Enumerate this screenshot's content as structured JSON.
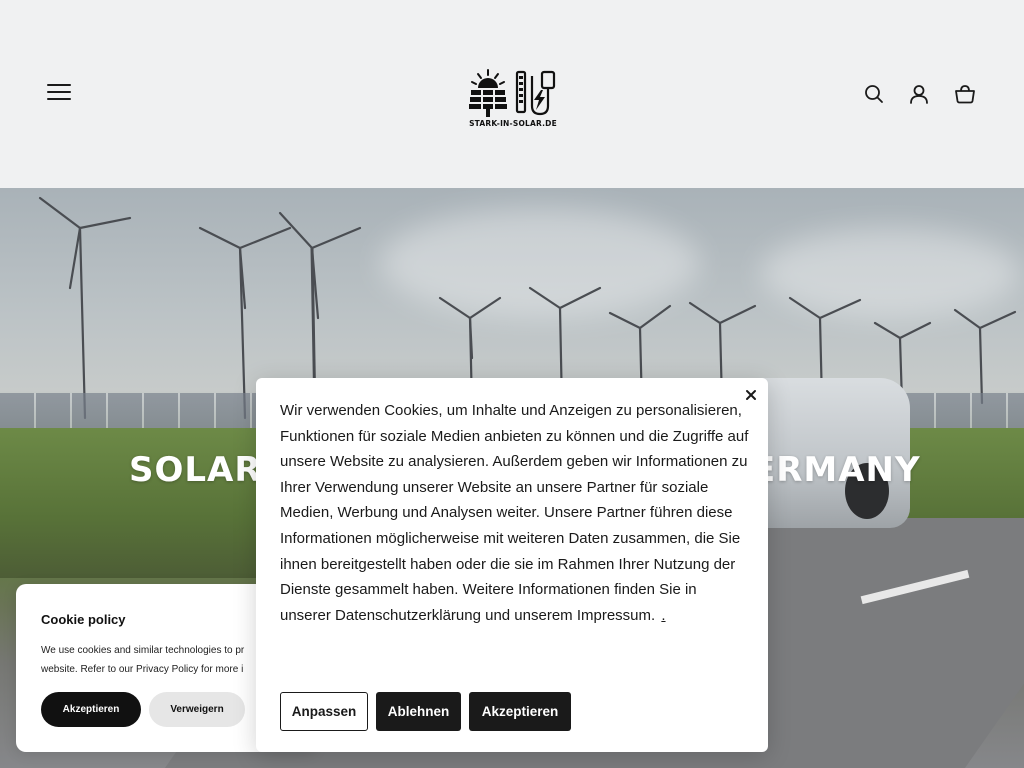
{
  "header": {
    "logo_text": "STARK-IN-SOLAR.DE",
    "menu_icon": "hamburger-menu-icon",
    "search_icon": "search-icon",
    "account_icon": "user-account-icon",
    "cart_icon": "shopping-basket-icon"
  },
  "hero": {
    "title_left": "SOLAR &",
    "title_right": "ERMANY"
  },
  "cookie_policy": {
    "title": "Cookie policy",
    "text_line1": "We use cookies and similar technologies to pr",
    "text_line2": "website. Refer to our Privacy Policy for more i",
    "accept_label": "Akzeptieren",
    "decline_label": "Verweigern"
  },
  "consent_modal": {
    "text": "Wir verwenden Cookies, um Inhalte und Anzeigen zu personalisieren, Funktionen für soziale Medien anbieten zu können und die Zugriffe auf unsere Website zu analysieren. Außerdem geben wir Informationen zu Ihrer Verwendung unserer Website an unsere Partner für soziale Medien, Werbung und Analysen weiter. Unsere Partner führen diese Informationen möglicherweise mit weiteren Daten zusammen, die Sie ihnen bereitgestellt haben oder die sie im Rahmen Ihrer Nutzung der Dienste gesammelt haben. Weitere Informationen finden Sie in unserer Datenschutzerklärung und unserem Impressum.",
    "link_text": ".",
    "customize_label": "Anpassen",
    "reject_label": "Ablehnen",
    "accept_label": "Akzeptieren",
    "close_icon": "close-icon"
  },
  "colors": {
    "header_bg": "#f0f1f2",
    "button_dark": "#1a1a1a",
    "button_light": "#e6e6e6"
  }
}
